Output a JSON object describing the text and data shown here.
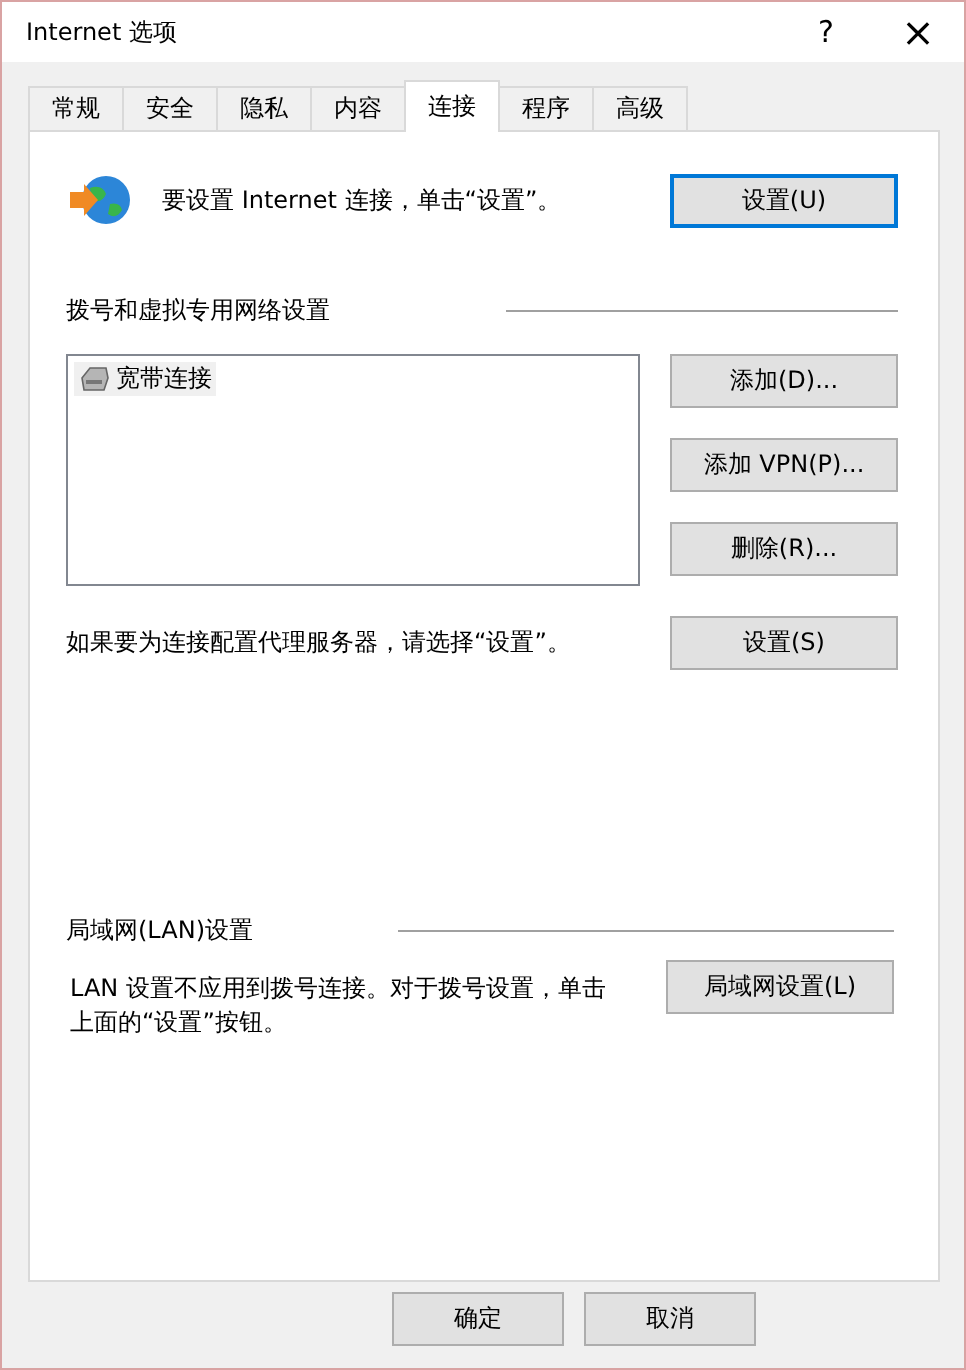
{
  "window": {
    "title": "Internet 选项",
    "help": "?",
    "close": "×"
  },
  "tabs": [
    {
      "label": "常规",
      "selected": false
    },
    {
      "label": "安全",
      "selected": false
    },
    {
      "label": "隐私",
      "selected": false
    },
    {
      "label": "内容",
      "selected": false
    },
    {
      "label": "连接",
      "selected": true
    },
    {
      "label": "程序",
      "selected": false
    },
    {
      "label": "高级",
      "selected": false
    }
  ],
  "setup": {
    "text": "要设置 Internet 连接，单击“设置”。",
    "button": "设置(U)"
  },
  "dialup": {
    "heading": "拨号和虚拟专用网络设置",
    "connections": [
      {
        "label": "宽带连接",
        "selected": true
      }
    ],
    "buttons": [
      "添加(D)...",
      "添加 VPN(P)...",
      "删除(R)..."
    ],
    "proxy_text": "如果要为连接配置代理服务器，请选择“设置”。",
    "settings_button": "设置(S)"
  },
  "lan": {
    "heading": "局域网(LAN)设置",
    "text": "LAN 设置不应用到拨号连接。对于拨号设置，单击上面的“设置”按钮。",
    "button": "局域网设置(L)"
  },
  "footer_buttons": [
    "确定",
    "取消"
  ]
}
